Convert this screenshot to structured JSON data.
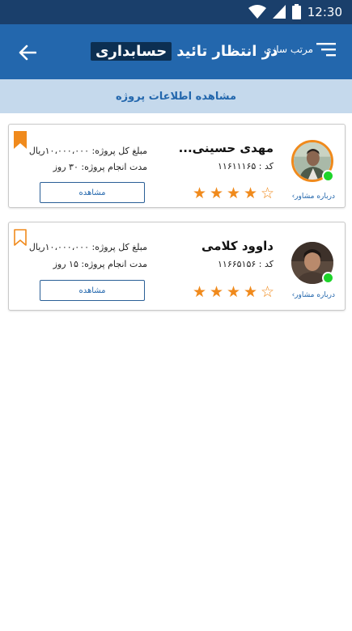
{
  "status_bar": {
    "time": "12:30",
    "icons": [
      "wifi-icon",
      "signal-icon",
      "battery-icon"
    ]
  },
  "app_bar": {
    "title_main": "در انتظار تائید",
    "title_highlight": "حسابداری",
    "sort_label": "مرتب سازی",
    "icons": [
      "back-arrow-icon",
      "sort-icon"
    ]
  },
  "sub_header": {
    "label": "مشاهده اطلاعات پروژه"
  },
  "colors": {
    "app_bar": "#2367ad",
    "status_bar": "#1a3f6b",
    "sub_header": "#c5d9ec",
    "accent_orange": "#f08a1c",
    "online_green": "#1ed42a"
  },
  "cards": [
    {
      "name": "مهدی حسینی...",
      "code": "کد : ۱۱۶۱۱۱۶۵",
      "amount": "مبلغ کل پروژه: ۱۰،۰۰۰،۰۰۰ریال",
      "duration": "مدت انجام پروژه: ۳۰ روز",
      "view_label": "مشاهده",
      "about_label": "درباره مشاور›",
      "rating": 4,
      "rating_max": 5,
      "online": true,
      "bookmarked": true
    },
    {
      "name": "داوود کلامی",
      "code": "کد : ۱۱۶۶۵۱۵۶",
      "amount": "مبلغ کل پروژه: ۱۰،۰۰۰،۰۰۰ریال",
      "duration": "مدت انجام پروژه: ۱۵ روز",
      "view_label": "مشاهده",
      "about_label": "درباره مشاور›",
      "rating": 4,
      "rating_max": 5,
      "online": true,
      "bookmarked": false
    }
  ]
}
